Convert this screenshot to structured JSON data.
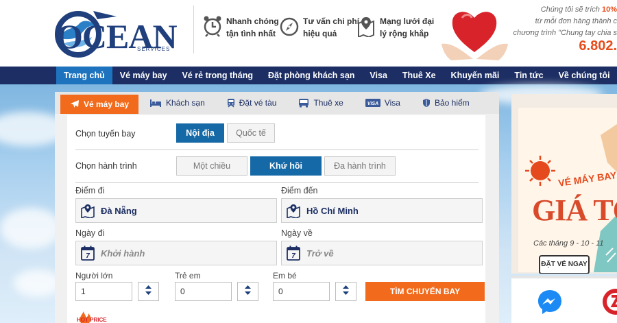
{
  "header": {
    "logo_text": "OCEAN",
    "logo_sub": "SERVICES",
    "features": [
      {
        "icon": "alarm-clock-icon",
        "line1": "Nhanh chóng",
        "line2": "tận tình nhất"
      },
      {
        "icon": "compass-icon",
        "line1": "Tư vấn chi phí",
        "line2": "hiệu quả"
      },
      {
        "icon": "map-pin-icon",
        "line1": "Mạng lưới đại",
        "line2": "lý rộng khắp"
      }
    ],
    "promo_line1_prefix": "Chúng tôi sẽ trích ",
    "promo_line1_highlight": "10%",
    "promo_line2": "từ mỗi đơn hàng thành c",
    "promo_line3": "chương trình \"Chung tay chia s",
    "promo_number": "6.802."
  },
  "nav": {
    "items": [
      "Trang chủ",
      "Vé máy bay",
      "Vé rẻ trong tháng",
      "Đặt phòng khách sạn",
      "Visa",
      "Thuê Xe",
      "Khuyến mãi",
      "Tin tức",
      "Về chúng tôi"
    ],
    "active_index": 0
  },
  "tabs": [
    {
      "label": "Vé máy bay",
      "icon": "airplane-icon",
      "active": true
    },
    {
      "label": "Khách sạn",
      "icon": "bed-icon",
      "active": false
    },
    {
      "label": "Đặt vé tàu",
      "icon": "train-icon",
      "active": false
    },
    {
      "label": "Thuê xe",
      "icon": "bus-icon",
      "active": false
    },
    {
      "label": "Visa",
      "icon": "visa-card-icon",
      "active": false
    },
    {
      "label": "Bảo hiểm",
      "icon": "shield-icon",
      "active": false
    }
  ],
  "form": {
    "route_label": "Chọn tuyến bay",
    "route_options": [
      "Nội địa",
      "Quốc tế"
    ],
    "route_selected": "Nội địa",
    "trip_label": "Chọn hành trình",
    "trip_options": [
      "Một chiều",
      "Khứ hồi",
      "Đa hành trình"
    ],
    "trip_selected": "Khứ hồi",
    "from_label": "Điểm đi",
    "from_value": "Đà Nẵng",
    "to_label": "Điểm đến",
    "to_value": "Hồ Chí Minh",
    "depart_label": "Ngày đi",
    "depart_placeholder": "Khởi hành",
    "return_label": "Ngày về",
    "return_placeholder": "Trở về",
    "calendar_day": "7",
    "adults_label": "Người lớn",
    "adults_value": "1",
    "children_label": "Trẻ em",
    "children_value": "0",
    "infants_label": "Em bé",
    "infants_value": "0",
    "search_button": "TÌM CHUYẾN BAY"
  },
  "ad": {
    "title1": "VÉ MÁY BAY",
    "title2": "GIÁ TỐT",
    "subtitle": "Các tháng 9 - 10 - 11",
    "button": "ĐẶT VÉ NGAY"
  },
  "hot_price": "HOT PRICE",
  "colors": {
    "nav_bg": "#1c2e63",
    "nav_active": "#1e73be",
    "accent_orange": "#f26a1b",
    "selected_blue": "#1569a6"
  }
}
